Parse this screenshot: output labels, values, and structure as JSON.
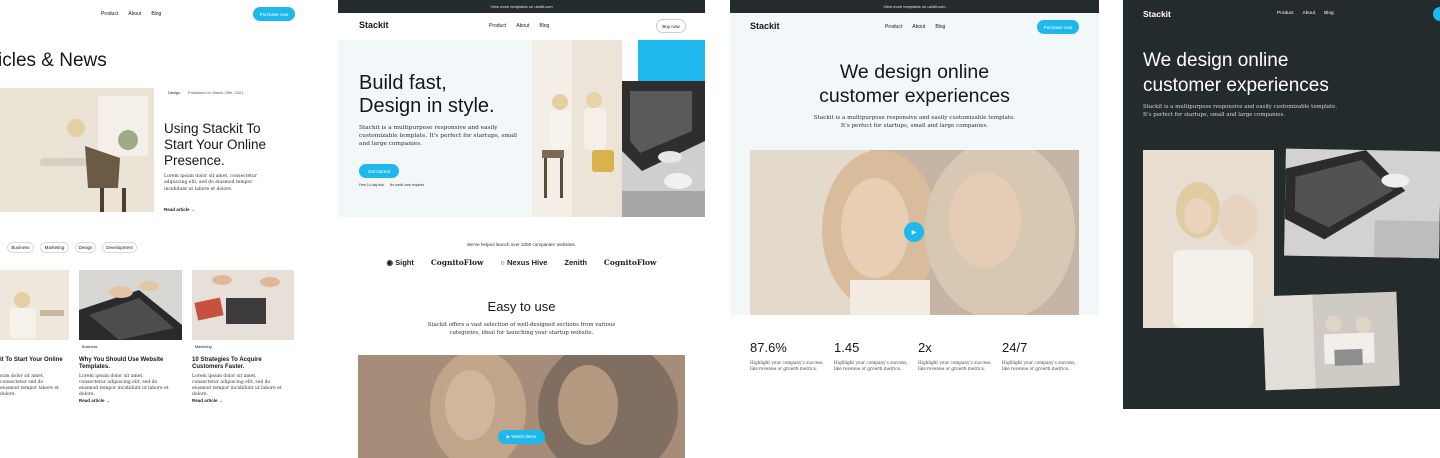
{
  "panel1": {
    "nav": {
      "links": [
        "Product",
        "About",
        "Blog"
      ],
      "cta": "Purchase now"
    },
    "heading": "icles & News",
    "featured": {
      "tag": "Design",
      "published": "Published on March 29th, 2021",
      "title": "Using Stackit To Start Your Online Presence.",
      "excerpt": "Lorem ipsum dolor sit amet, consectetur adipiscing elit, sed do eiusmod tempor incididunt ut labore et dolore.",
      "read": "Read article →"
    },
    "filters": [
      "Business",
      "Marketing",
      "Design",
      "Development"
    ],
    "cards": [
      {
        "tag": "",
        "title": "it To Start Your Online",
        "excerpt": "sum dolor sit amet, consectetur sed do eiusmod tempor labore et dolore.",
        "read": ""
      },
      {
        "tag": "Business",
        "title": "Why You Should Use Website Templates.",
        "excerpt": "Lorem ipsum dolor sit amet, consectetur adipiscing elit, sed do eiusmod tempor incididunt ut labore et dolore.",
        "read": "Read article →"
      },
      {
        "tag": "Marketing",
        "title": "10 Strategies To Acquire Customers Faster.",
        "excerpt": "Lorem ipsum dolor sit amet, consectetur adipiscing elit, sed do eiusmod tempor incididunt ut labore et dolore.",
        "read": "Read article →"
      }
    ]
  },
  "panel2": {
    "banner": "View more templates on uiddit.com",
    "logo": "Stackit",
    "nav": {
      "links": [
        "Product",
        "About",
        "Blog"
      ],
      "cta": "Buy now"
    },
    "hero": {
      "title_line1": "Build fast,",
      "title_line2": "Design in style.",
      "body": "Stackit is a multipurpose responsive and easily customizable template. It's perfect for startups, small and large companies.",
      "cta": "Get started",
      "note1": "Free 14-day trial",
      "note2": "No credit card required"
    },
    "logos_caption": "We've helped launch over 1000 companies' websites.",
    "logos": [
      "Sight",
      "CognitoFlow",
      "Nexus Hive",
      "Zenith",
      "CognitoFlow"
    ],
    "section_title": "Easy to use",
    "section_body": "Stackit offers a vast selection of well-designed sections from various categories, ideal for launching your startup website.",
    "video_cta": "▶ Watch demo"
  },
  "panel3": {
    "banner": "View more templates on uiddit.com",
    "logo": "Stackit",
    "nav": {
      "links": [
        "Product",
        "About",
        "Blog"
      ],
      "cta": "Purchase now"
    },
    "hero_line1": "We design online",
    "hero_line2": "customer experiences",
    "hero_body_line1": "Stackit is a multipurpose responsive and easily customizable template.",
    "hero_body_line2": "It's perfect for startups, small and large companies.",
    "stats": [
      {
        "value": "87.6%",
        "desc": "Highlight your company's success, like revenue or growth metrics."
      },
      {
        "value": "1.45",
        "desc": "Highlight your company's success, like revenue or growth metrics."
      },
      {
        "value": "2x",
        "desc": "Highlight your company's success, like revenue or growth metrics."
      },
      {
        "value": "24/7",
        "desc": "Highlight your company's success, like revenue or growth metrics."
      }
    ]
  },
  "panel4": {
    "logo": "Stackit",
    "nav": {
      "links": [
        "Product",
        "About",
        "Blog"
      ]
    },
    "hero_line1": "We design online",
    "hero_line2": "customer experiences",
    "hero_body_line1": "Stackit is a multipurpose responsive and easily customizable template.",
    "hero_body_line2": "It's perfect for startups, small and large companies."
  },
  "colors": {
    "accent": "#1fb8ec",
    "dark": "#232b2d",
    "light_bg": "#f2f7fa",
    "text": "#14181b"
  }
}
